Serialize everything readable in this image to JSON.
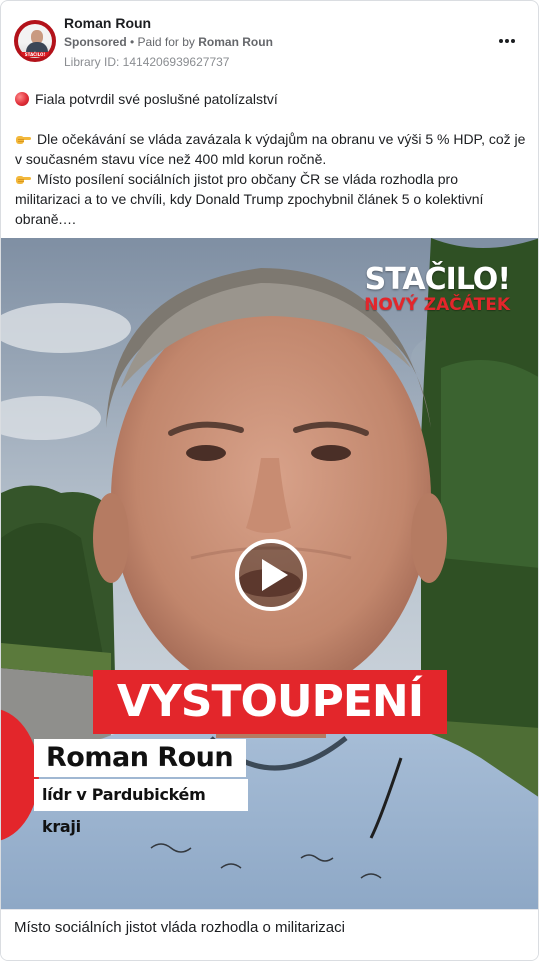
{
  "post": {
    "page_name": "Roman Roun",
    "sponsored_label": "Sponsored",
    "separator": " • ",
    "paid_for_by_label": "Paid for by ",
    "payer": "Roman Roun",
    "library_id": "Library ID: 1414206939627737",
    "avatar_badge": "STAČILO!",
    "more_icon": "more-horizontal-icon"
  },
  "body": {
    "p1": "Fiala potvrdil své poslušné patolízalství",
    "p2": "Dle očekávání se vláda zavázala k výdajům na obranu ve výši 5 % HDP, což je v současném stavu více než 400 mld korun ročně.",
    "p3": "Místo posílení sociálních jistot pro občany ČR se vláda rozhodla pro militarizaci a to ve chvíli, kdy Donald Trump zpochybnil článek 5 o kolektivní obraně.…",
    "icons": [
      "red-circle-icon",
      "pointing-hand-icon",
      "pointing-hand-icon"
    ]
  },
  "video": {
    "brand_main": "STAČILO!",
    "brand_sub": "NOVÝ ZAČÁTEK",
    "banner": "VYSTOUPENÍ",
    "name": "Roman Roun",
    "role": "lídr v Pardubickém kraji",
    "play_icon": "play-icon",
    "colors": {
      "brand_red": "#e3262b",
      "text_white": "#ffffff"
    }
  },
  "caption": "Místo sociálních jistot vláda rozhodla o militarizaci"
}
